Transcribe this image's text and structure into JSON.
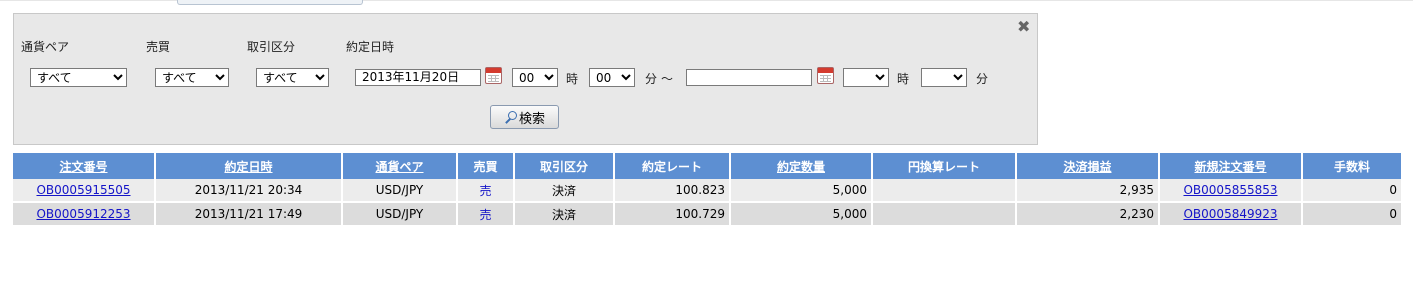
{
  "filters": {
    "currency_pair": {
      "label": "通貨ペア",
      "value": "すべて"
    },
    "side": {
      "label": "売買",
      "value": "すべて"
    },
    "trade_type": {
      "label": "取引区分",
      "value": "すべて"
    },
    "executed_at": {
      "label": "約定日時",
      "from_date": "2013年11月20日",
      "from_hour": "00",
      "hour_unit": "時",
      "from_minute": "00",
      "minute_unit": "分",
      "range_sep": "～",
      "to_date": "",
      "to_hour": "",
      "to_minute": ""
    },
    "search_label": "検索"
  },
  "table": {
    "headers": [
      "注文番号",
      "約定日時",
      "通貨ペア",
      "売買",
      "取引区分",
      "約定レート",
      "約定数量",
      "円換算レート",
      "決済損益",
      "新規注文番号",
      "手数料"
    ],
    "rows": [
      [
        "OB0005915505",
        "2013/11/21 20:34",
        "USD/JPY",
        "売",
        "決済",
        "100.823",
        "5,000",
        "",
        "2,935",
        "OB0005855853",
        "0"
      ],
      [
        "OB0005912253",
        "2013/11/21 17:49",
        "USD/JPY",
        "売",
        "決済",
        "100.729",
        "5,000",
        "",
        "2,230",
        "OB0005849923",
        "0"
      ]
    ]
  },
  "icons": {
    "close": "close-icon",
    "calendar": "calendar-icon",
    "search": "search-icon"
  },
  "colors": {
    "header_bg": "#5d8fd2",
    "link": "#1414c8",
    "panel_bg": "#e8e8e8"
  }
}
